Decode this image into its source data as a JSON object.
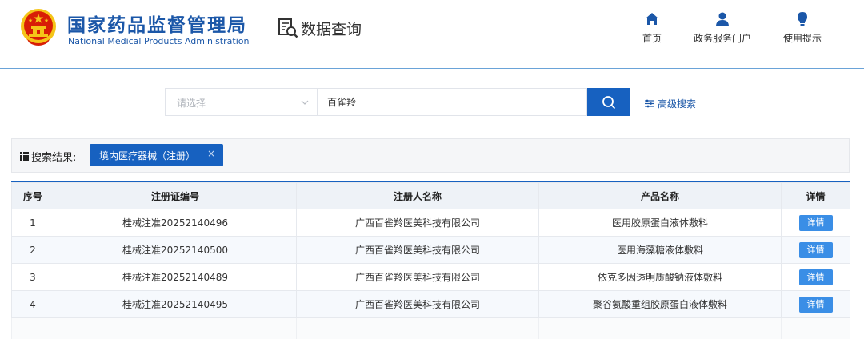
{
  "header": {
    "title_cn": "国家药品监督管理局",
    "title_en": "National Medical Products Administration",
    "section": "数据查询",
    "nav": [
      {
        "label": "首页",
        "icon": "home-icon"
      },
      {
        "label": "政务服务门户",
        "icon": "user-icon"
      },
      {
        "label": "使用提示",
        "icon": "bulb-icon"
      }
    ]
  },
  "search": {
    "select_placeholder": "请选择",
    "query": "百雀羚",
    "advanced": "高级搜索"
  },
  "results": {
    "label": "搜索结果:",
    "tag": "境内医疗器械（注册）",
    "tag_close": "×"
  },
  "table": {
    "headers": [
      "序号",
      "注册证编号",
      "注册人名称",
      "产品名称",
      "详情"
    ],
    "rows": [
      {
        "no": "1",
        "cert": "桂械注准20252140496",
        "registrant": "广西百雀羚医美科技有限公司",
        "product": "医用胶原蛋白液体敷料",
        "action": "详情"
      },
      {
        "no": "2",
        "cert": "桂械注准20252140500",
        "registrant": "广西百雀羚医美科技有限公司",
        "product": "医用海藻糖液体敷料",
        "action": "详情"
      },
      {
        "no": "3",
        "cert": "桂械注准20252140489",
        "registrant": "广西百雀羚医美科技有限公司",
        "product": "依克多因透明质酸钠液体敷料",
        "action": "详情"
      },
      {
        "no": "4",
        "cert": "桂械注准20252140495",
        "registrant": "广西百雀羚医美科技有限公司",
        "product": "聚谷氨酸重组胶原蛋白液体敷料",
        "action": "详情"
      }
    ]
  },
  "colors": {
    "brand": "#1b57a8",
    "primary": "#1761c0",
    "detail": "#3a8ee6",
    "emblem_red": "#d81e06",
    "emblem_gold": "#f5c518"
  }
}
